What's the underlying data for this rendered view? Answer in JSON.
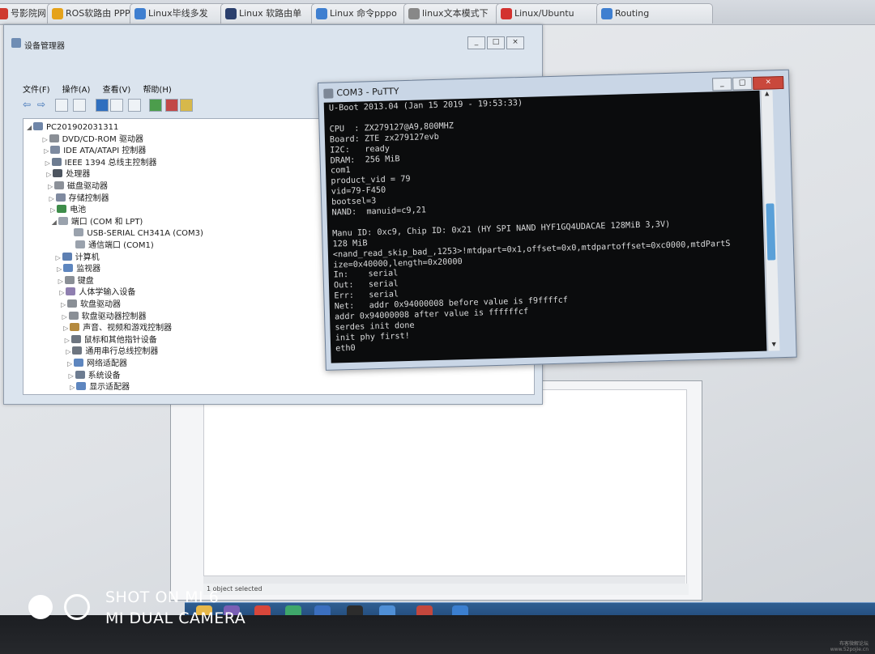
{
  "browser_tabs": [
    {
      "label": "号影院网  店",
      "color": "#cf3a2e"
    },
    {
      "label": "ROS软路由 PPP",
      "color": "#e5a21a"
    },
    {
      "label": "Linux毕线多发",
      "color": "#3f7fd0"
    },
    {
      "label": "Linux 软路由单",
      "color": "#2a3f6d"
    },
    {
      "label": "Linux 命令pppo",
      "color": "#3f7fd0"
    },
    {
      "label": "linux文本模式下",
      "color": "#888888"
    },
    {
      "label": "Linux/Ubuntu",
      "color": "#d3322f"
    },
    {
      "label": "Routing",
      "color": "#3f7fd0"
    }
  ],
  "device_manager": {
    "title": "设备管理器",
    "menu": [
      "文件(F)",
      "操作(A)",
      "查看(V)",
      "帮助(H)"
    ],
    "window_buttons": [
      "_",
      "□",
      "×"
    ],
    "tree": [
      {
        "label": "PC201902031311",
        "level": 0,
        "expander": "◢"
      },
      {
        "label": "DVD/CD-ROM 驱动器",
        "level": 1,
        "expander": "▷"
      },
      {
        "label": "IDE ATA/ATAPI 控制器",
        "level": 1,
        "expander": "▷"
      },
      {
        "label": "IEEE 1394 总线主控制器",
        "level": 1,
        "expander": "▷"
      },
      {
        "label": "处理器",
        "level": 1,
        "expander": "▷"
      },
      {
        "label": "磁盘驱动器",
        "level": 1,
        "expander": "▷"
      },
      {
        "label": "存储控制器",
        "level": 1,
        "expander": "▷"
      },
      {
        "label": "电池",
        "level": 1,
        "expander": "▷"
      },
      {
        "label": "端口 (COM 和 LPT)",
        "level": 1,
        "expander": "◢"
      },
      {
        "label": "USB-SERIAL CH341A (COM3)",
        "level": 2,
        "expander": ""
      },
      {
        "label": "通信端口 (COM1)",
        "level": 2,
        "expander": ""
      },
      {
        "label": "计算机",
        "level": 1,
        "expander": "▷"
      },
      {
        "label": "监视器",
        "level": 1,
        "expander": "▷"
      },
      {
        "label": "键盘",
        "level": 1,
        "expander": "▷"
      },
      {
        "label": "人体学输入设备",
        "level": 1,
        "expander": "▷"
      },
      {
        "label": "软盘驱动器",
        "level": 1,
        "expander": "▷"
      },
      {
        "label": "软盘驱动器控制器",
        "level": 1,
        "expander": "▷"
      },
      {
        "label": "声音、视频和游戏控制器",
        "level": 1,
        "expander": "▷"
      },
      {
        "label": "鼠标和其他指针设备",
        "level": 1,
        "expander": "▷"
      },
      {
        "label": "通用串行总线控制器",
        "level": 1,
        "expander": "▷"
      },
      {
        "label": "网络适配器",
        "level": 1,
        "expander": "▷"
      },
      {
        "label": "系统设备",
        "level": 1,
        "expander": "▷"
      },
      {
        "label": "显示适配器",
        "level": 1,
        "expander": "▷"
      }
    ]
  },
  "putty": {
    "title": "COM3 - PuTTY",
    "window_buttons": [
      "_",
      "□",
      "×"
    ],
    "lines": [
      "U-Boot 2013.04 (Jan 15 2019 - 19:53:33)",
      "",
      "CPU  : ZX279127@A9,800MHZ",
      "Board: ZTE zx279127evb",
      "I2C:   ready",
      "DRAM:  256 MiB",
      "com1",
      "product_vid = 79",
      "vid=79-F450",
      "bootsel=3",
      "NAND:  manuid=c9,21",
      "",
      "Manu ID: 0xc9, Chip ID: 0x21 (HY SPI NAND HYF1GQ4UDACAE 128MiB 3,3V)",
      "128 MiB",
      "<nand_read_skip_bad_,1253>!mtdpart=0x1,offset=0x0,mtdpartoffset=0xc0000,mtdPartS",
      "ize=0x40000,length=0x20000",
      "In:    serial",
      "Out:   serial",
      "Err:   serial",
      "Net:   addr 0x94000008 before value is f9ffffcf",
      "addr 0x94000008 after value is ffffffcf",
      "serdes init done",
      "init phy first!",
      "eth0"
    ]
  },
  "background_window": {
    "status_text": "1 object selected"
  },
  "watermark": {
    "line1": "SHOT ON MI 6",
    "line2": "MI DUAL CAMERA"
  },
  "corner_text": "布客微解论坛\nwww.52pojie.cn",
  "taskbar_icons": [
    "folder-icon",
    "media-player-icon",
    "chrome-icon",
    "play-store-icon",
    "virtualbox-icon",
    "terminal-icon",
    "network-icon",
    "photo-icon",
    "remote-desktop-icon"
  ]
}
